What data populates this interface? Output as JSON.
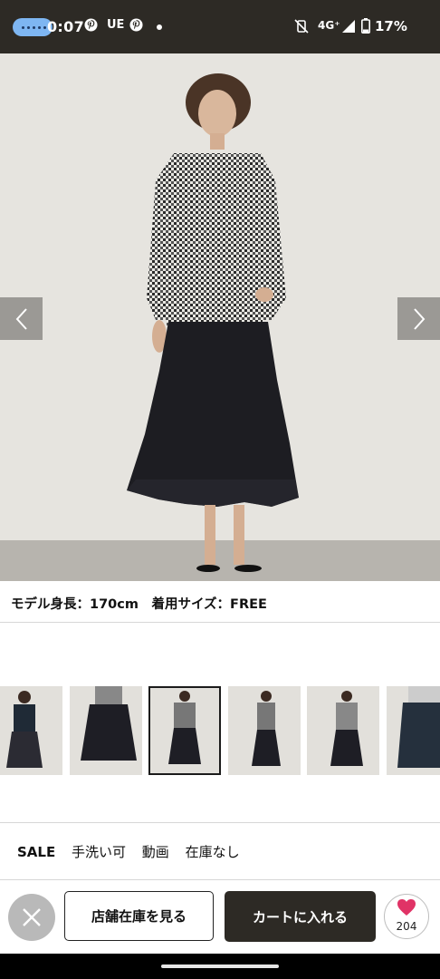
{
  "status_bar": {
    "time": "0:07",
    "notif_label": "UE",
    "network": "4G⁺",
    "battery": "17%"
  },
  "hero": {
    "prev_label": "‹",
    "next_label": "›"
  },
  "model_info": "モデル身長：170cm　着用サイズ：FREE",
  "thumbnails": {
    "count": 6,
    "selected_index": 2
  },
  "tags": [
    "SALE",
    "手洗い可",
    "動画",
    "在庫なし"
  ],
  "actions": {
    "close_icon": "close-icon",
    "store_stock_label": "店舗在庫を見る",
    "add_to_cart_label": "カートに入れる",
    "favorite_count": "204"
  },
  "colors": {
    "dark": "#2d2a25",
    "heart": "#e03366",
    "pill": "#7eb6f2"
  }
}
